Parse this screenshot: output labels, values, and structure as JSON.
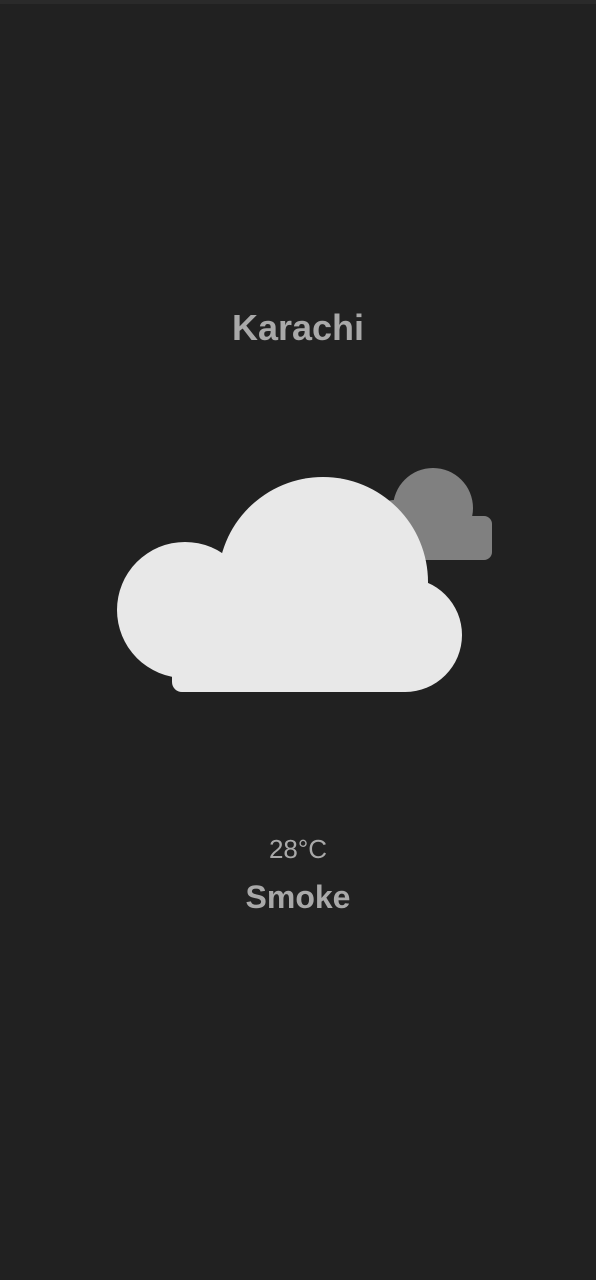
{
  "weather": {
    "city": "Karachi",
    "temperature": "28°C",
    "condition": "Smoke",
    "icon": "cloudy-icon"
  },
  "colors": {
    "background": "#212121",
    "text": "#a9a9a9",
    "cloud_front": "#e8e8e8",
    "cloud_back": "#808080"
  }
}
